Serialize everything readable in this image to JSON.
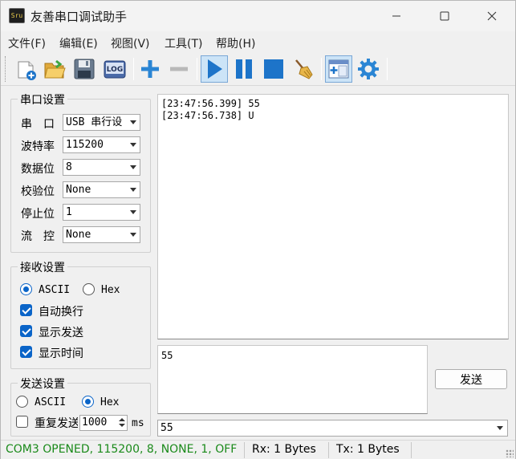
{
  "window": {
    "title": "友善串口调试助手",
    "app_icon_text": "Sru"
  },
  "menu": [
    "文件(F)",
    "编辑(E)",
    "视图(V)",
    "工具(T)",
    "帮助(H)"
  ],
  "toolbar": {
    "log_label": "LOG",
    "icons": [
      "new-file-icon",
      "open-folder-icon",
      "save-disk-icon",
      "log-icon",
      "add-icon",
      "remove-icon",
      "play-icon",
      "pause-icon",
      "stop-icon",
      "broom-clear-icon",
      "window-layout-icon",
      "settings-gear-icon"
    ]
  },
  "serial_settings": {
    "title": "串口设置",
    "port_label": "串　口",
    "port_value": "USB 串行设",
    "baud_label": "波特率",
    "baud_value": "115200",
    "databits_label": "数据位",
    "databits_value": "8",
    "parity_label": "校验位",
    "parity_value": "None",
    "stopbits_label": "停止位",
    "stopbits_value": "1",
    "flow_label": "流　控",
    "flow_value": "None"
  },
  "receive_settings": {
    "title": "接收设置",
    "ascii_label": "ASCII",
    "hex_label": "Hex",
    "mode": "ascii",
    "auto_wrap_label": "自动换行",
    "auto_wrap": true,
    "show_send_label": "显示发送",
    "show_send": true,
    "show_time_label": "显示时间",
    "show_time": true
  },
  "send_settings": {
    "title": "发送设置",
    "ascii_label": "ASCII",
    "hex_label": "Hex",
    "mode": "hex",
    "repeat_label": "重复发送",
    "repeat": false,
    "interval_value": "1000",
    "interval_unit": "ms"
  },
  "receive_log": [
    "[23:47:56.399] 55",
    "[23:47:56.738] U"
  ],
  "send_text": "55",
  "send_button": "发送",
  "history_value": "55",
  "status": {
    "connection": "COM3 OPENED, 115200, 8, NONE, 1, OFF",
    "connection_color": "#1a8a1a",
    "rx": "Rx: 1 Bytes",
    "tx": "Tx: 1 Bytes"
  }
}
